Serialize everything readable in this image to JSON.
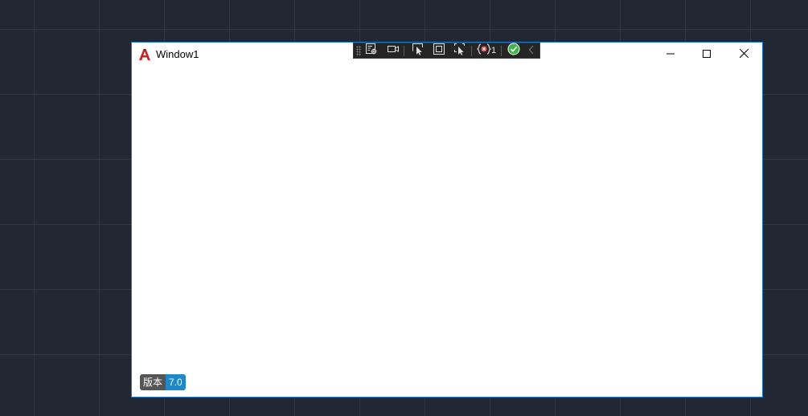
{
  "window": {
    "title": "Window1",
    "icon": "autocad-a-icon",
    "controls": {
      "minimize_icon": "minimize-icon",
      "maximize_icon": "maximize-icon",
      "close_icon": "close-icon"
    }
  },
  "dev_toolbar": {
    "binding_failure_count": "1",
    "tools": [
      "select-visual-tree-icon",
      "record-icon",
      "select-element-icon",
      "display-layout-adorners-icon",
      "track-focused-element-icon",
      "binding-failures-icon",
      "hot-reload-ok-icon",
      "collapse-toolbar-icon"
    ]
  },
  "version_badge": {
    "label": "版本",
    "value": "7.0"
  },
  "colors": {
    "desktop_background": "#212833",
    "grid_line": "#2f3745",
    "window_border": "#1e78c8",
    "toolbar_background": "#252526",
    "badge_label": "#555555",
    "badge_value": "#1e88c8",
    "hot_reload_ok": "#3cb44a",
    "binding_error": "#e04a4a"
  }
}
